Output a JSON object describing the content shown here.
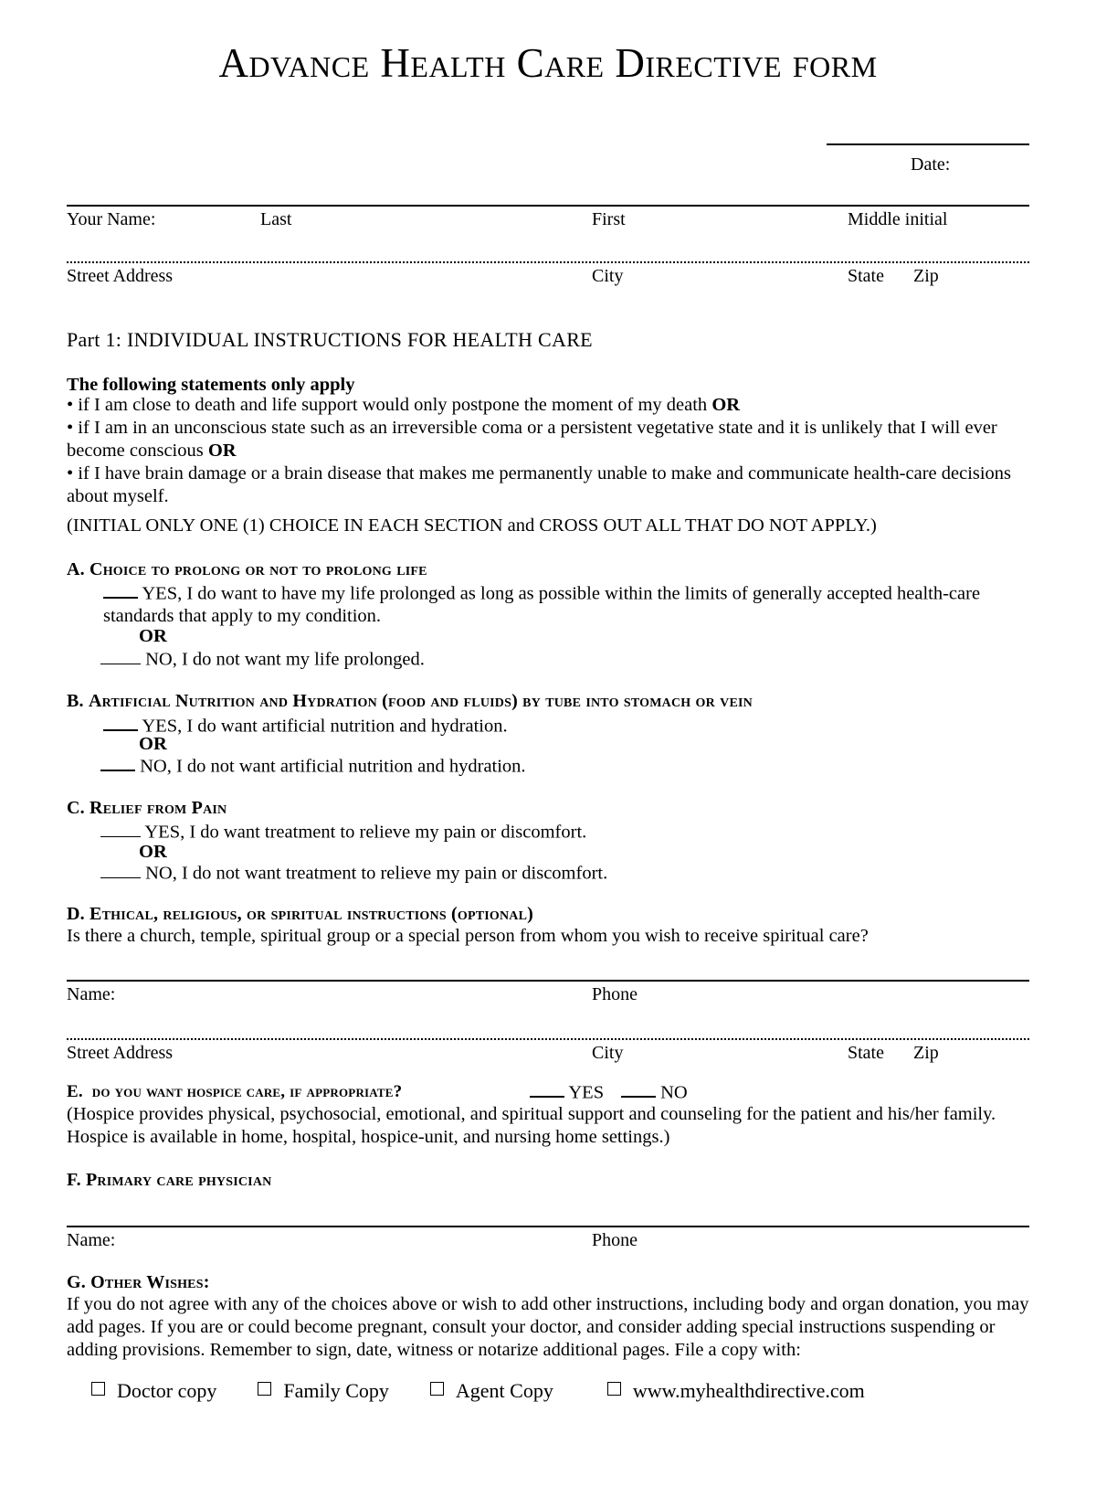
{
  "document": {
    "title": "Advance Health Care Directive form"
  },
  "header": {
    "date_label": "Date:",
    "name_row": {
      "your_name": "Your Name:",
      "last": "Last",
      "first": "First",
      "middle_initial": "Middle initial"
    },
    "address_row": {
      "street_address": "Street Address",
      "city": "City",
      "state": "State",
      "zip": "Zip"
    }
  },
  "part1": {
    "heading": "Part 1: INDIVIDUAL INSTRUCTIONS FOR HEALTH CARE",
    "intro_bold": "The following statements only apply",
    "bullet1_text": "• if I am close to death and life support would only postpone the moment of my death ",
    "bullet1_or": "OR",
    "bullet2_text": "• if I am in an unconscious state such as an irreversible coma or a persistent vegetative state and it is unlikely that I will ever become conscious ",
    "bullet2_or": "OR",
    "bullet3_text": "• if I have brain damage or a brain disease that makes me permanently unable to make and communicate health-care decisions about myself.",
    "initial_instruction": "(INITIAL ONLY ONE (1) CHOICE IN EACH SECTION and CROSS OUT ALL THAT DO NOT APPLY.)"
  },
  "section_a": {
    "letter": "A.",
    "heading": "Choice to prolong or not to prolong life",
    "yes_text": "YES, I do want to have my life prolonged as long as possible within the limits of generally accepted health-care standards that apply to my condition.",
    "or": "OR",
    "no_text": "NO, I do not want my life prolonged."
  },
  "section_b": {
    "letter": "B.",
    "heading": "Artificial Nutrition and Hydration (food and fluids) by tube into stomach or vein",
    "yes_text": "YES, I do want artificial nutrition and hydration.",
    "or": "OR",
    "no_text": "NO, I do not want artificial nutrition and hydration."
  },
  "section_c": {
    "letter": "C.",
    "heading": "Relief from Pain",
    "yes_text": "YES, I do want treatment to relieve my pain or discomfort.",
    "or": "OR",
    "no_text": "NO, I do not want treatment to relieve my pain or discomfort."
  },
  "section_d": {
    "letter": "D.",
    "heading": "Ethical, religious, or spiritual instructions (optional)",
    "question": "Is there a church, temple, spiritual group or a special person from whom you wish to receive spiritual care?",
    "name_label": "Name:",
    "phone_label": "Phone",
    "street_address": "Street Address",
    "city": "City",
    "state": "State",
    "zip": "Zip"
  },
  "section_e": {
    "letter": "E.",
    "heading": "do you want hospice care, if appropriate?",
    "yes_label": "YES",
    "no_label": "NO",
    "note_line1": "(Hospice provides physical, psychosocial, emotional, and spiritual support and counseling for the patient and his/her family.",
    "note_line2": "Hospice is available in home, hospital, hospice-unit, and nursing home settings.)"
  },
  "section_f": {
    "letter": "F.",
    "heading": "Primary care physician",
    "name_label": "Name:",
    "phone_label": "Phone"
  },
  "section_g": {
    "letter": "G.",
    "heading": "Other Wishes:",
    "body": "If you do not agree with any of the choices above or wish to add other instructions, including body and organ donation, you may add pages. If you are or could become pregnant, consult your doctor, and consider adding special instructions suspending or adding provisions.  Remember to sign, date, witness or notarize additional pages.  File a copy with:"
  },
  "file_copy_options": [
    {
      "label": "Doctor copy"
    },
    {
      "label": "Family Copy"
    },
    {
      "label": "Agent Copy"
    },
    {
      "label": "www.myhealthdirective.com"
    }
  ]
}
